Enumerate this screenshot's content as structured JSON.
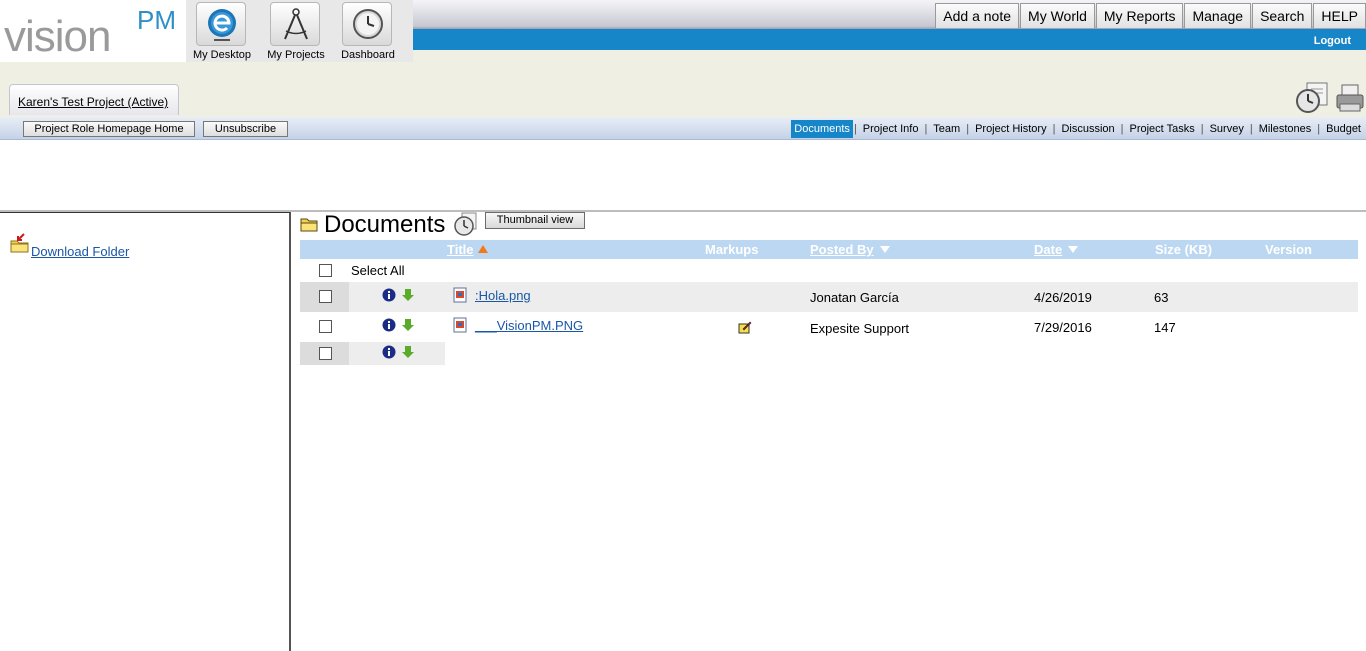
{
  "logo": {
    "word": "vision",
    "suffix": "PM",
    "tm": "™"
  },
  "quicklaunch": [
    {
      "label": "My Desktop",
      "icon": "desktop-e-icon"
    },
    {
      "label": "My Projects",
      "icon": "compass-icon"
    },
    {
      "label": "Dashboard",
      "icon": "clock-icon"
    }
  ],
  "topmenu": [
    "Add a note",
    "My World",
    "My Reports",
    "Manage",
    "Search",
    "HELP"
  ],
  "logout": "Logout",
  "project_tab": "Karen's Test Project (Active)",
  "actions": {
    "homepage": "Project Role Homepage Home",
    "unsubscribe": "Unsubscribe"
  },
  "tabs": [
    "Documents",
    "Project Info",
    "Team",
    "Project History",
    "Discussion",
    "Project Tasks",
    "Survey",
    "Milestones",
    "Budget"
  ],
  "active_tab": "Documents",
  "left": {
    "download_folder": "Download Folder"
  },
  "documents": {
    "title": "Documents",
    "thumbnail_button": "Thumbnail view",
    "columns": {
      "title": "Title",
      "markups": "Markups",
      "posted_by": "Posted By",
      "date": "Date",
      "size": "Size (KB)",
      "version": "Version"
    },
    "select_all": "Select All",
    "rows": [
      {
        "name": ":Hola.png",
        "markup": false,
        "posted_by": "Jonatan García",
        "date": "4/26/2019",
        "size": "63"
      },
      {
        "name": "___VisionPM.PNG",
        "markup": true,
        "posted_by": "Expesite Support",
        "date": "7/29/2016",
        "size": "147"
      }
    ]
  },
  "colors": {
    "accent": "#1686c8",
    "link": "#1a57a6",
    "header_band": "#efefe3",
    "table_header": "#bcd7f1"
  }
}
